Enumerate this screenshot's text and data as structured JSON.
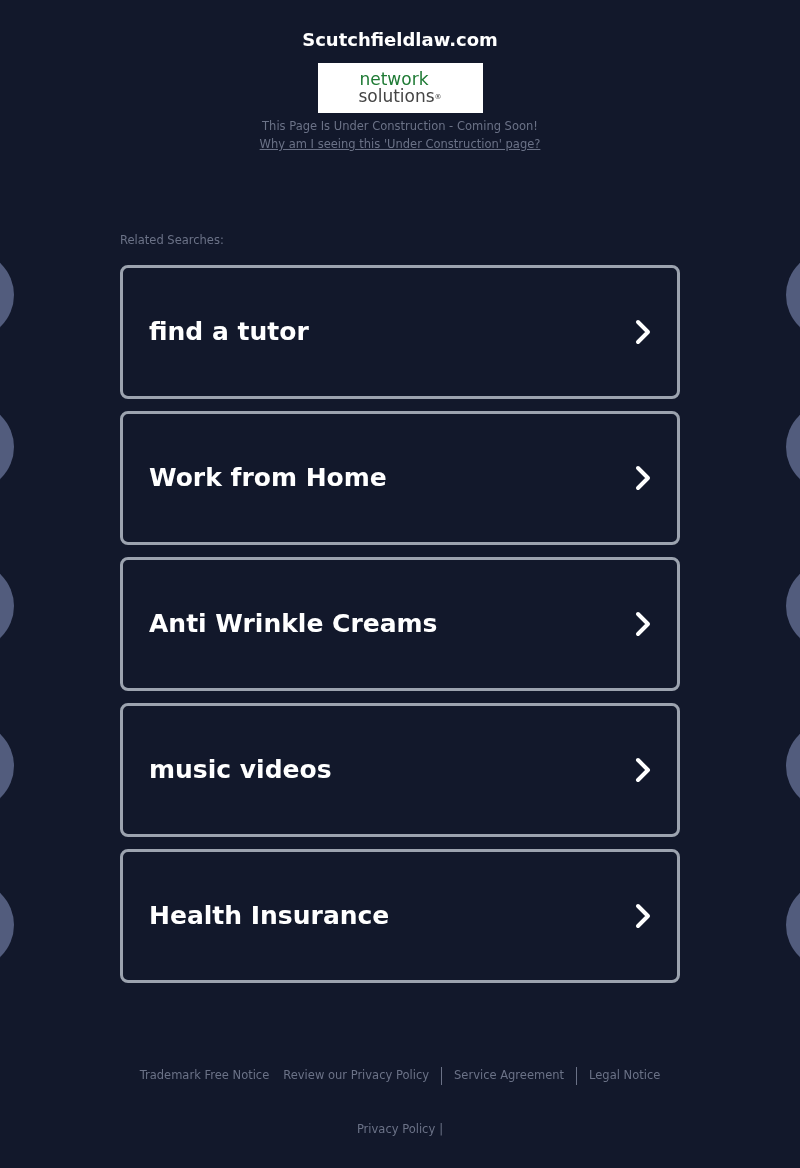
{
  "site_title": "Scutchfieldlaw.com",
  "logo": {
    "line_1": "network",
    "line_2": "solutions",
    "mark": "®"
  },
  "notice": "This Page Is Under Construction - Coming Soon!",
  "notice_link": "Why am I seeing this 'Under Construction' page?",
  "related_heading": "Related Searches:",
  "searches": [
    "find a tutor",
    "Work from Home",
    "Anti Wrinkle Creams",
    "music videos",
    "Health Insurance"
  ],
  "footer_links": [
    "Trademark Free Notice",
    "Review our Privacy Policy",
    "Service Agreement",
    "Legal Notice"
  ],
  "bottom_link": "Privacy Policy",
  "bottom_separator": "|"
}
